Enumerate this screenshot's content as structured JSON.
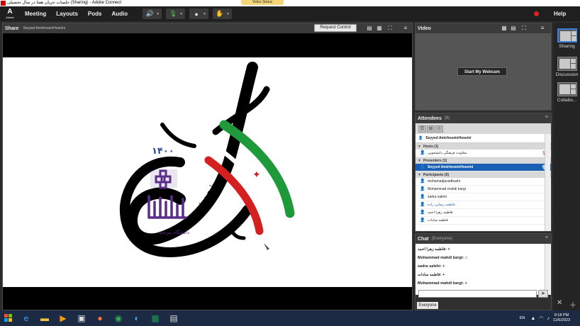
{
  "window": {
    "title": "جلسات جریان هفتا در سال تحصیلی (Sharing) - Adobe Connect",
    "status_pill": "Video Status"
  },
  "logo": {
    "mark": "A",
    "sub": "Adobe"
  },
  "menu": [
    "Meeting",
    "Layouts",
    "Pods",
    "Audio"
  ],
  "toolbar_icons": [
    "speaker-icon",
    "microphone-icon",
    "webcam-icon",
    "raise-hand-icon"
  ],
  "help_label": "Help",
  "share_pod": {
    "title": "Share",
    "presenter": "Seyyed AmirhoseinHoseini",
    "request_control": "Request Control",
    "slide_text": {
      "year": "۱۴۰۰",
      "main": "طرح همتا",
      "university": "دانشگاه بیرجند"
    }
  },
  "video_pod": {
    "title": "Video",
    "webcam_button": "Start My Webcam"
  },
  "attendees_pod": {
    "title": "Attendees",
    "count": "(8)",
    "me": "Seyyed AmirhoseinHoseini",
    "groups": [
      {
        "label": "Hosts (1)",
        "rows": [
          {
            "name": "معاونت فرهنگی دانشجویی",
            "selected": false,
            "blue": false,
            "right_icon": true
          }
        ]
      },
      {
        "label": "Presenters (1)",
        "rows": [
          {
            "name": "Seyyed AmirhoseinHoseini",
            "selected": true,
            "blue": false,
            "right_icon": true
          }
        ]
      },
      {
        "label": "Participants (6)",
        "rows": [
          {
            "name": "mohamadjavadbashi",
            "selected": false,
            "blue": false,
            "right_icon": false
          },
          {
            "name": "Mohammad mahdi bargi",
            "selected": false,
            "blue": false,
            "right_icon": false
          },
          {
            "name": "sadra salehi",
            "selected": false,
            "blue": false,
            "right_icon": false
          },
          {
            "name": "فاطمه رضایی زاده",
            "selected": false,
            "blue": true,
            "right_icon": false
          },
          {
            "name": "فاطمه زهرا احمد",
            "selected": false,
            "blue": false,
            "right_icon": false
          },
          {
            "name": "فاطمه سادات",
            "selected": false,
            "blue": false,
            "right_icon": false
          }
        ]
      }
    ]
  },
  "chat_pod": {
    "title": "Chat",
    "scope": "(Everyone)",
    "messages": [
      "فاطمه زهرا احمد: +",
      "Mohammad mahdi bargi: ::",
      "sadra salehi: +",
      "فاطمه سادات: +",
      "Mohammad mahdi bargi: +"
    ],
    "tab": "Everyone"
  },
  "layouts": [
    {
      "label": "Sharing",
      "active": true
    },
    {
      "label": "Discussion",
      "active": false
    },
    {
      "label": "Collabo...",
      "active": false
    }
  ],
  "taskbar": {
    "apps": [
      "start-icon",
      "ie-icon",
      "file-explorer-icon",
      "media-player-icon",
      "video-editor-icon",
      "firefox-icon",
      "chrome-icon",
      "edge-icon",
      "excel-icon",
      "notepad-icon"
    ],
    "language": "EN",
    "time": "9:18 PM",
    "date": "11/6/2023"
  },
  "colors": {
    "accent": "#1a5fb4",
    "record": "#e02020",
    "taskbar": "#1c2a44"
  }
}
